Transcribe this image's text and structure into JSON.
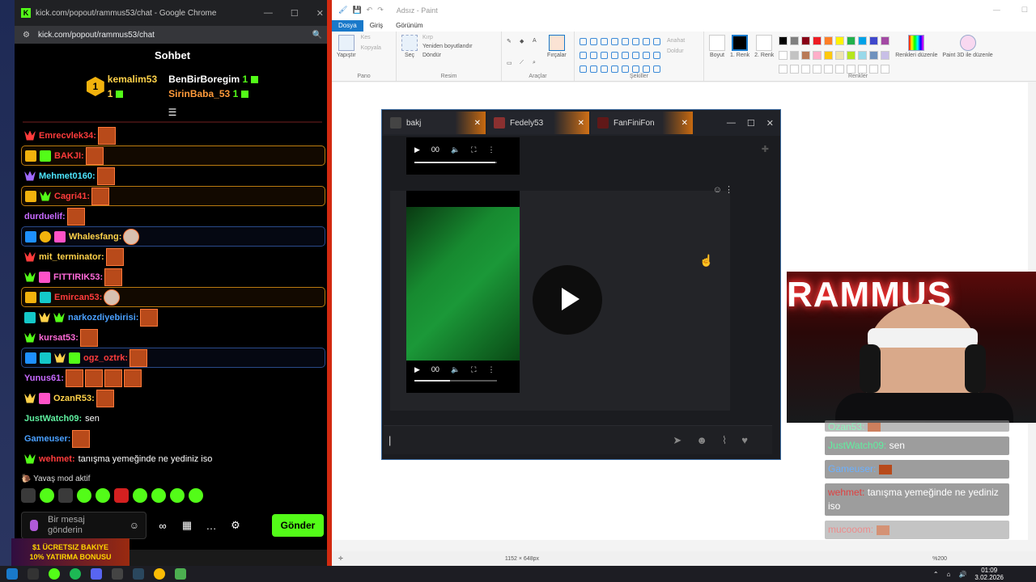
{
  "chrome": {
    "title": "kick.com/popout/rammus53/chat - Google Chrome",
    "url": "kick.com/popout/rammus53/chat",
    "chat_title": "Sohbet",
    "leaders": [
      {
        "rank": "1",
        "name": "kemalim53",
        "count": "1"
      },
      {
        "name": "BenBirBoregim",
        "count": "1"
      },
      {
        "name": "SirinBaba_53",
        "count": "1"
      }
    ],
    "messages": [
      {
        "user": "Emrecvlek34:",
        "color": "#ff3c3c",
        "text": ""
      },
      {
        "user": "BAKJI:",
        "color": "#ff3c3c",
        "text": ""
      },
      {
        "user": "Mehmet0160:",
        "color": "#4de6ff",
        "text": ""
      },
      {
        "user": "Cagri41:",
        "color": "#ff3c3c",
        "text": ""
      },
      {
        "user": "durduelif:",
        "color": "#c86aff",
        "text": ""
      },
      {
        "user": "Whalesfang:",
        "color": "#ffd24a",
        "text": ""
      },
      {
        "user": "mit_terminator:",
        "color": "#ffd24a",
        "text": ""
      },
      {
        "user": "FITTIRIK53:",
        "color": "#ff6ad8",
        "text": ""
      },
      {
        "user": "Emircan53:",
        "color": "#ff3c3c",
        "text": ""
      },
      {
        "user": "narkozdiyebirisi:",
        "color": "#4aa0ff",
        "text": ""
      },
      {
        "user": "kursat53:",
        "color": "#ff6ad8",
        "text": ""
      },
      {
        "user": "ogz_oztrk:",
        "color": "#ff3c3c",
        "text": ""
      },
      {
        "user": "Yunus61:",
        "color": "#c86aff",
        "text": ""
      },
      {
        "user": "OzanR53:",
        "color": "#ffd24a",
        "text": ""
      },
      {
        "user": "JustWatch09:",
        "color": "#5ff0a0",
        "text": "sen"
      },
      {
        "user": "Gameuser:",
        "color": "#4aa0ff",
        "text": ""
      },
      {
        "user": "wehmet:",
        "color": "#ff3c3c",
        "text": "tanışma yemeğinde ne yediniz iso"
      }
    ],
    "slow_mode": "Yavaş mod aktif",
    "input_placeholder_line1": "Bir mesaj",
    "input_placeholder_line2": "gönderin",
    "send_label": "Gönder",
    "promo_line1": "$1 ÜCRETSIZ BAKIYE",
    "promo_line2": "10% YATIRMA BONUSU"
  },
  "paint": {
    "title": "Adsız - Paint",
    "tabs": [
      "Dosya",
      "Giriş",
      "Görünüm"
    ],
    "groups": {
      "pano": "Pano",
      "resim": "Resim",
      "araclar": "Araçlar",
      "sekiller": "Şekiller",
      "renkler": "Renkler"
    },
    "tools": {
      "paste": "Yapıştır",
      "cut": "Kes",
      "copy": "Kopyala",
      "select": "Seç",
      "crop": "Kırp",
      "resize": "Yeniden boyutlandır",
      "rotate": "Döndür",
      "brushes": "Fırçalar",
      "outline": "Anahat",
      "fill": "Doldur",
      "size": "Boyut",
      "color1": "1. Renk",
      "color2": "2. Renk",
      "edit_colors": "Renkleri düzenle",
      "paint3d": "Paint 3D ile düzenle"
    },
    "dimensions": "1152 × 648px",
    "zoom": "%200"
  },
  "discord": {
    "tabs": [
      "bakj",
      "Fedely53",
      "FanFiniFon"
    ],
    "video_time": "00"
  },
  "overlay": {
    "rows": [
      {
        "user": "Ozan53:",
        "cls": "",
        "text": ""
      },
      {
        "user": "JustWatch09:",
        "cls": "",
        "text": "sen"
      },
      {
        "user": "Gameuser:",
        "cls": "blue",
        "text": ""
      },
      {
        "user": "wehmet:",
        "cls": "red",
        "text": "tanışma yemeğinde ne yediniz iso"
      },
      {
        "user": "mucooom:",
        "cls": "red",
        "text": ""
      }
    ]
  },
  "webcam": {
    "sign_text": "RAMMUS"
  },
  "taskbar": {
    "time": "01:09",
    "date": "3.02.2026"
  },
  "colors": {
    "kick_green": "#53fc18",
    "paint_blue": "#1979ca"
  }
}
